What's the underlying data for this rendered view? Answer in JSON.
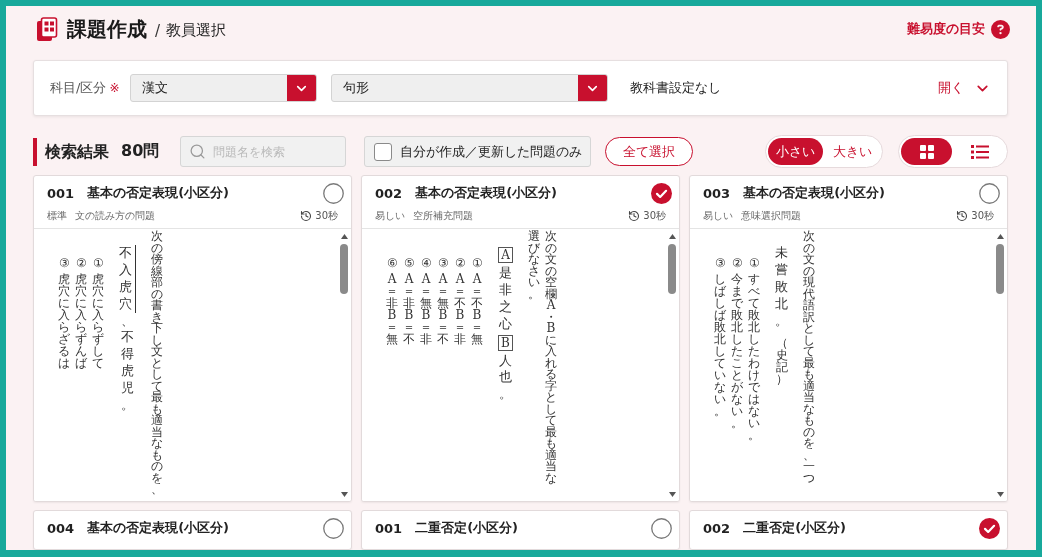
{
  "header": {
    "title": "課題作成",
    "separator": "/",
    "subtitle": "教員選択",
    "help_link": "難易度の目安"
  },
  "filter": {
    "label": "科目/区分",
    "required_mark": "※",
    "selects": [
      {
        "value": "漢文"
      },
      {
        "value": "句形"
      }
    ],
    "textbook": "教科書設定なし",
    "toggle": {
      "label": "開く",
      "expanded": false
    }
  },
  "results": {
    "title": "検索結果",
    "count": "80問",
    "search": {
      "placeholder": "問題名を検索"
    },
    "own_only": {
      "label": "自分が作成／更新した問題のみ",
      "checked": false
    },
    "select_all": "全て選択",
    "sizes": [
      {
        "label": "小さい",
        "selected": true
      },
      {
        "label": "大きい",
        "selected": false
      }
    ],
    "views": [
      {
        "kind": "grid",
        "selected": true
      },
      {
        "kind": "list",
        "selected": false
      }
    ]
  },
  "cards": [
    {
      "number": "001",
      "title": "基本の否定表現(小区分)",
      "selected": false,
      "difficulty": "標準",
      "question_type": "文の読み方の問題",
      "time": "30秒",
      "preview": {
        "instruction": "次の傍線部の書き下し文として最も適当なものを、",
        "passage": [
          {
            "kind": "sideline",
            "text": "不入虎穴"
          },
          {
            "kind": "text",
            "text": "、不得虎児。"
          }
        ],
        "options": [
          {
            "marker": "③",
            "text": "虎穴に入らざるは"
          },
          {
            "marker": "②",
            "text": "虎穴に入らずんば"
          },
          {
            "marker": "①",
            "text": "虎穴に入らずして"
          }
        ]
      }
    },
    {
      "number": "002",
      "title": "基本の否定表現(小区分)",
      "selected": true,
      "difficulty": "易しい",
      "question_type": "空所補充問題",
      "time": "30秒",
      "preview": {
        "instruction": "次の文の空欄A・Bに入れる字として最も適当な",
        "instruction_end": "選びなさい。",
        "passage": [
          {
            "kind": "blank",
            "text": "A"
          },
          {
            "kind": "text",
            "text": "是非之心"
          },
          {
            "kind": "blank",
            "text": "B"
          },
          {
            "kind": "text",
            "text": "人也。"
          }
        ],
        "options": [
          {
            "marker": "⑥",
            "text": "A＝非　B＝無"
          },
          {
            "marker": "⑤",
            "text": "A＝非　B＝不"
          },
          {
            "marker": "④",
            "text": "A＝無　B＝非"
          },
          {
            "marker": "③",
            "text": "A＝無　B＝不"
          },
          {
            "marker": "②",
            "text": "A＝不　B＝非"
          },
          {
            "marker": "①",
            "text": "A＝不　B＝無"
          }
        ]
      }
    },
    {
      "number": "003",
      "title": "基本の否定表現(小区分)",
      "selected": false,
      "difficulty": "易しい",
      "question_type": "意味選択問題",
      "time": "30秒",
      "preview": {
        "instruction": "次の文の現代語訳として最も適当なものを、一つ",
        "passage": [
          {
            "kind": "text",
            "text": "未嘗敗北。"
          }
        ],
        "source": "（史記）",
        "options": [
          {
            "marker": "③",
            "text": "しばしば敗北していない。"
          },
          {
            "marker": "②",
            "text": "今まで敗北したことがない。"
          },
          {
            "marker": "①",
            "text": "すべて敗北したわけではない。"
          }
        ]
      }
    },
    {
      "number": "004",
      "title": "基本の否定表現(小区分)",
      "selected": false
    },
    {
      "number": "001",
      "title": "二重否定(小区分)",
      "selected": false
    },
    {
      "number": "002",
      "title": "二重否定(小区分)",
      "selected": true
    }
  ]
}
